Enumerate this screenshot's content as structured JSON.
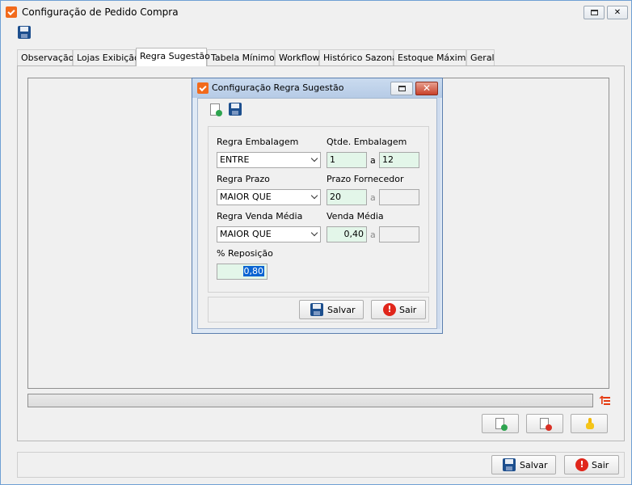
{
  "window": {
    "title": "Configuração de Pedido Compra"
  },
  "tabs": [
    {
      "label": "Observação"
    },
    {
      "label": "Lojas Exibição"
    },
    {
      "label": "Regra Sugestão"
    },
    {
      "label": "Tabela Mínimos"
    },
    {
      "label": "Workflow"
    },
    {
      "label": "Histórico Sazonal"
    },
    {
      "label": "Estoque Máximo"
    },
    {
      "label": "Geral"
    }
  ],
  "active_tab": "Regra Sugestão",
  "footer": {
    "save_label": "Salvar",
    "exit_label": "Sair",
    "exit_glyph": "!"
  },
  "dialog": {
    "title": "Configuração Regra Sugestão",
    "regra_embalagem": {
      "label": "Regra Embalagem",
      "value": "ENTRE"
    },
    "qtde_embalagem": {
      "label": "Qtde. Embalagem",
      "from": "1",
      "sep": "a",
      "to": "12"
    },
    "regra_prazo": {
      "label": "Regra Prazo",
      "value": "MAIOR QUE"
    },
    "prazo_fornecedor": {
      "label": "Prazo Fornecedor",
      "from": "20",
      "sep": "a",
      "to": ""
    },
    "regra_venda_media": {
      "label": "Regra Venda Média",
      "value": "MAIOR QUE"
    },
    "venda_media": {
      "label": "Venda Média",
      "from": "0,40",
      "sep": "a",
      "to": ""
    },
    "reposicao": {
      "label": "% Reposição",
      "value": "0,80"
    },
    "save_label": "Salvar",
    "exit_label": "Sair"
  },
  "colors": {
    "accent": "#f26a1b",
    "field_bg": "#e3f6e9",
    "exit_red": "#e0261b",
    "save_blue": "#1d4f8e"
  }
}
